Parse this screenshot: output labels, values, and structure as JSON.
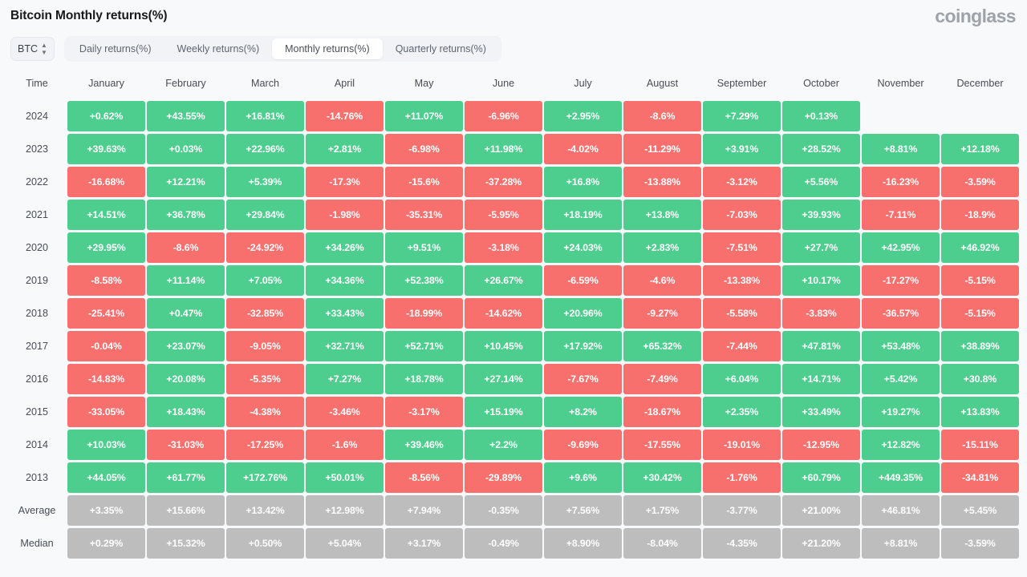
{
  "header": {
    "title": "Bitcoin Monthly returns(%)",
    "brand": "coinglass"
  },
  "toolbar": {
    "symbol": "BTC",
    "symbol_icon": "stepper-updown-icon",
    "tabs": [
      {
        "label": "Daily returns(%)",
        "active": false
      },
      {
        "label": "Weekly returns(%)",
        "active": false
      },
      {
        "label": "Monthly returns(%)",
        "active": true
      },
      {
        "label": "Quarterly returns(%)",
        "active": false
      }
    ]
  },
  "colors": {
    "positive": "#4ece8e",
    "negative": "#f8706e",
    "neutral": "#bdbdbd",
    "background": "#f8f9fa",
    "text": "#474c55"
  },
  "chart_data": {
    "type": "heatmap",
    "title": "Bitcoin Monthly returns(%)",
    "xlabel": "",
    "ylabel": "Time",
    "legend": "Green = positive return, Red = negative return, Gray = summary rows",
    "columns": [
      "Time",
      "January",
      "February",
      "March",
      "April",
      "May",
      "June",
      "July",
      "August",
      "September",
      "October",
      "November",
      "December"
    ],
    "categories": [
      "January",
      "February",
      "March",
      "April",
      "May",
      "June",
      "July",
      "August",
      "September",
      "October",
      "November",
      "December"
    ],
    "rows": [
      {
        "label": "2024",
        "kind": "year",
        "values": [
          "+0.62%",
          "+43.55%",
          "+16.81%",
          "-14.76%",
          "+11.07%",
          "-6.96%",
          "+2.95%",
          "-8.6%",
          "+7.29%",
          "+0.13%",
          "",
          ""
        ],
        "numeric": [
          0.62,
          43.55,
          16.81,
          -14.76,
          11.07,
          -6.96,
          2.95,
          -8.6,
          7.29,
          0.13,
          null,
          null
        ]
      },
      {
        "label": "2023",
        "kind": "year",
        "values": [
          "+39.63%",
          "+0.03%",
          "+22.96%",
          "+2.81%",
          "-6.98%",
          "+11.98%",
          "-4.02%",
          "-11.29%",
          "+3.91%",
          "+28.52%",
          "+8.81%",
          "+12.18%"
        ],
        "numeric": [
          39.63,
          0.03,
          22.96,
          2.81,
          -6.98,
          11.98,
          -4.02,
          -11.29,
          3.91,
          28.52,
          8.81,
          12.18
        ]
      },
      {
        "label": "2022",
        "kind": "year",
        "values": [
          "-16.68%",
          "+12.21%",
          "+5.39%",
          "-17.3%",
          "-15.6%",
          "-37.28%",
          "+16.8%",
          "-13.88%",
          "-3.12%",
          "+5.56%",
          "-16.23%",
          "-3.59%"
        ],
        "numeric": [
          -16.68,
          12.21,
          5.39,
          -17.3,
          -15.6,
          -37.28,
          16.8,
          -13.88,
          -3.12,
          5.56,
          -16.23,
          -3.59
        ]
      },
      {
        "label": "2021",
        "kind": "year",
        "values": [
          "+14.51%",
          "+36.78%",
          "+29.84%",
          "-1.98%",
          "-35.31%",
          "-5.95%",
          "+18.19%",
          "+13.8%",
          "-7.03%",
          "+39.93%",
          "-7.11%",
          "-18.9%"
        ],
        "numeric": [
          14.51,
          36.78,
          29.84,
          -1.98,
          -35.31,
          -5.95,
          18.19,
          13.8,
          -7.03,
          39.93,
          -7.11,
          -18.9
        ]
      },
      {
        "label": "2020",
        "kind": "year",
        "values": [
          "+29.95%",
          "-8.6%",
          "-24.92%",
          "+34.26%",
          "+9.51%",
          "-3.18%",
          "+24.03%",
          "+2.83%",
          "-7.51%",
          "+27.7%",
          "+42.95%",
          "+46.92%"
        ],
        "numeric": [
          29.95,
          -8.6,
          -24.92,
          34.26,
          9.51,
          -3.18,
          24.03,
          2.83,
          -7.51,
          27.7,
          42.95,
          46.92
        ]
      },
      {
        "label": "2019",
        "kind": "year",
        "values": [
          "-8.58%",
          "+11.14%",
          "+7.05%",
          "+34.36%",
          "+52.38%",
          "+26.67%",
          "-6.59%",
          "-4.6%",
          "-13.38%",
          "+10.17%",
          "-17.27%",
          "-5.15%"
        ],
        "numeric": [
          -8.58,
          11.14,
          7.05,
          34.36,
          52.38,
          26.67,
          -6.59,
          -4.6,
          -13.38,
          10.17,
          -17.27,
          -5.15
        ]
      },
      {
        "label": "2018",
        "kind": "year",
        "values": [
          "-25.41%",
          "+0.47%",
          "-32.85%",
          "+33.43%",
          "-18.99%",
          "-14.62%",
          "+20.96%",
          "-9.27%",
          "-5.58%",
          "-3.83%",
          "-36.57%",
          "-5.15%"
        ],
        "numeric": [
          -25.41,
          0.47,
          -32.85,
          33.43,
          -18.99,
          -14.62,
          20.96,
          -9.27,
          -5.58,
          -3.83,
          -36.57,
          -5.15
        ]
      },
      {
        "label": "2017",
        "kind": "year",
        "values": [
          "-0.04%",
          "+23.07%",
          "-9.05%",
          "+32.71%",
          "+52.71%",
          "+10.45%",
          "+17.92%",
          "+65.32%",
          "-7.44%",
          "+47.81%",
          "+53.48%",
          "+38.89%"
        ],
        "numeric": [
          -0.04,
          23.07,
          -9.05,
          32.71,
          52.71,
          10.45,
          17.92,
          65.32,
          -7.44,
          47.81,
          53.48,
          38.89
        ]
      },
      {
        "label": "2016",
        "kind": "year",
        "values": [
          "-14.83%",
          "+20.08%",
          "-5.35%",
          "+7.27%",
          "+18.78%",
          "+27.14%",
          "-7.67%",
          "-7.49%",
          "+6.04%",
          "+14.71%",
          "+5.42%",
          "+30.8%"
        ],
        "numeric": [
          -14.83,
          20.08,
          -5.35,
          7.27,
          18.78,
          27.14,
          -7.67,
          -7.49,
          6.04,
          14.71,
          5.42,
          30.8
        ]
      },
      {
        "label": "2015",
        "kind": "year",
        "values": [
          "-33.05%",
          "+18.43%",
          "-4.38%",
          "-3.46%",
          "-3.17%",
          "+15.19%",
          "+8.2%",
          "-18.67%",
          "+2.35%",
          "+33.49%",
          "+19.27%",
          "+13.83%"
        ],
        "numeric": [
          -33.05,
          18.43,
          -4.38,
          -3.46,
          -3.17,
          15.19,
          8.2,
          -18.67,
          2.35,
          33.49,
          19.27,
          13.83
        ]
      },
      {
        "label": "2014",
        "kind": "year",
        "values": [
          "+10.03%",
          "-31.03%",
          "-17.25%",
          "-1.6%",
          "+39.46%",
          "+2.2%",
          "-9.69%",
          "-17.55%",
          "-19.01%",
          "-12.95%",
          "+12.82%",
          "-15.11%"
        ],
        "numeric": [
          10.03,
          -31.03,
          -17.25,
          -1.6,
          39.46,
          2.2,
          -9.69,
          -17.55,
          -19.01,
          -12.95,
          12.82,
          -15.11
        ]
      },
      {
        "label": "2013",
        "kind": "year",
        "values": [
          "+44.05%",
          "+61.77%",
          "+172.76%",
          "+50.01%",
          "-8.56%",
          "-29.89%",
          "+9.6%",
          "+30.42%",
          "-1.76%",
          "+60.79%",
          "+449.35%",
          "-34.81%"
        ],
        "numeric": [
          44.05,
          61.77,
          172.76,
          50.01,
          -8.56,
          -29.89,
          9.6,
          30.42,
          -1.76,
          60.79,
          449.35,
          -34.81
        ]
      },
      {
        "label": "Average",
        "kind": "summary",
        "values": [
          "+3.35%",
          "+15.66%",
          "+13.42%",
          "+12.98%",
          "+7.94%",
          "-0.35%",
          "+7.56%",
          "+1.75%",
          "-3.77%",
          "+21.00%",
          "+46.81%",
          "+5.45%"
        ],
        "numeric": [
          3.35,
          15.66,
          13.42,
          12.98,
          7.94,
          -0.35,
          7.56,
          1.75,
          -3.77,
          21.0,
          46.81,
          5.45
        ]
      },
      {
        "label": "Median",
        "kind": "summary",
        "values": [
          "+0.29%",
          "+15.32%",
          "+0.50%",
          "+5.04%",
          "+3.17%",
          "-0.49%",
          "+8.90%",
          "-8.04%",
          "-4.35%",
          "+21.20%",
          "+8.81%",
          "-3.59%"
        ],
        "numeric": [
          0.29,
          15.32,
          0.5,
          5.04,
          3.17,
          -0.49,
          8.9,
          -8.04,
          -4.35,
          21.2,
          8.81,
          -3.59
        ]
      }
    ]
  }
}
